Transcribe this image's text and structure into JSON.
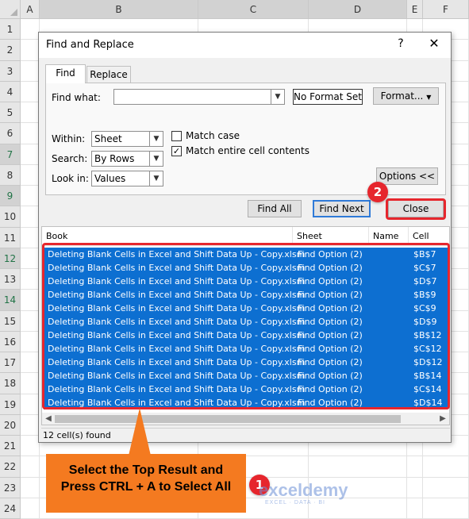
{
  "sheet": {
    "columns": [
      "A",
      "B",
      "C",
      "D",
      "E",
      "F"
    ],
    "rows": [
      "1",
      "2",
      "3",
      "4",
      "5",
      "6",
      "7",
      "8",
      "9",
      "10",
      "11",
      "12",
      "13",
      "14",
      "15",
      "16",
      "17",
      "18",
      "19",
      "20",
      "21",
      "22",
      "23",
      "24"
    ]
  },
  "dialog": {
    "title": "Find and Replace",
    "help_glyph": "?",
    "close_glyph": "✕",
    "tabs": {
      "find": "Find",
      "replace": "Replace"
    },
    "find_what_label": "Find what:",
    "find_what_value": "",
    "no_format_label": "No Format Set",
    "format_button": "Format...",
    "within_label": "Within:",
    "within_value": "Sheet",
    "search_label": "Search:",
    "search_value": "By Rows",
    "lookin_label": "Look in:",
    "lookin_value": "Values",
    "match_case_label": "Match case",
    "match_case_checked": false,
    "match_entire_label": "Match entire cell contents",
    "match_entire_checked": true,
    "options_button": "Options <<",
    "find_all_button": "Find All",
    "find_next_button": "Find Next",
    "close_button": "Close",
    "results": {
      "columns": [
        "Book",
        "Sheet",
        "Name",
        "Cell"
      ],
      "rows": [
        {
          "book": "Deleting Blank Cells in Excel and Shift Data Up - Copy.xlsm",
          "sheet": "Find Option (2)",
          "cell": "$B$7"
        },
        {
          "book": "Deleting Blank Cells in Excel and Shift Data Up - Copy.xlsm",
          "sheet": "Find Option (2)",
          "cell": "$C$7"
        },
        {
          "book": "Deleting Blank Cells in Excel and Shift Data Up - Copy.xlsm",
          "sheet": "Find Option (2)",
          "cell": "$D$7"
        },
        {
          "book": "Deleting Blank Cells in Excel and Shift Data Up - Copy.xlsm",
          "sheet": "Find Option (2)",
          "cell": "$B$9"
        },
        {
          "book": "Deleting Blank Cells in Excel and Shift Data Up - Copy.xlsm",
          "sheet": "Find Option (2)",
          "cell": "$C$9"
        },
        {
          "book": "Deleting Blank Cells in Excel and Shift Data Up - Copy.xlsm",
          "sheet": "Find Option (2)",
          "cell": "$D$9"
        },
        {
          "book": "Deleting Blank Cells in Excel and Shift Data Up - Copy.xlsm",
          "sheet": "Find Option (2)",
          "cell": "$B$12"
        },
        {
          "book": "Deleting Blank Cells in Excel and Shift Data Up - Copy.xlsm",
          "sheet": "Find Option (2)",
          "cell": "$C$12"
        },
        {
          "book": "Deleting Blank Cells in Excel and Shift Data Up - Copy.xlsm",
          "sheet": "Find Option (2)",
          "cell": "$D$12"
        },
        {
          "book": "Deleting Blank Cells in Excel and Shift Data Up - Copy.xlsm",
          "sheet": "Find Option (2)",
          "cell": "$B$14"
        },
        {
          "book": "Deleting Blank Cells in Excel and Shift Data Up - Copy.xlsm",
          "sheet": "Find Option (2)",
          "cell": "$C$14"
        },
        {
          "book": "Deleting Blank Cells in Excel and Shift Data Up - Copy.xlsm",
          "sheet": "Find Option (2)",
          "cell": "$D$14"
        }
      ]
    },
    "status_text": "12 cell(s) found"
  },
  "annotations": {
    "step1_badge": "1",
    "step2_badge": "2",
    "callout_line1": "Select the Top Result and",
    "callout_line2": "Press CTRL + A to Select All",
    "watermark_name": "exceldemy",
    "watermark_tagline": "EXCEL · DATA · BI",
    "accent_red": "#e6262d",
    "callout_orange": "#f47a20",
    "selection_blue": "#0d6fd1"
  }
}
